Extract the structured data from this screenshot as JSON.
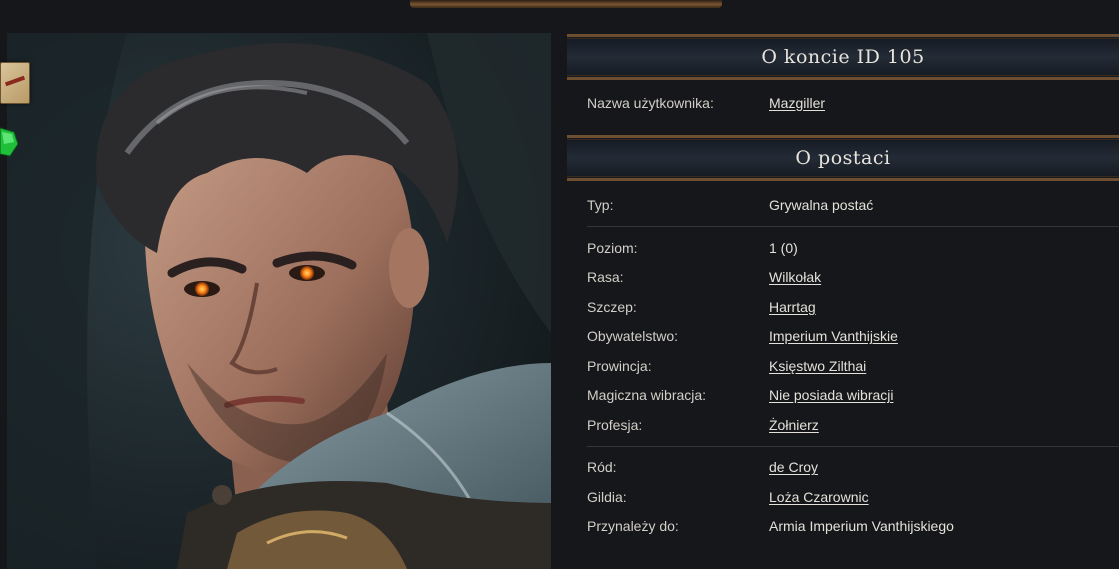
{
  "account_section": {
    "title": "O koncie ID 105",
    "rows": [
      {
        "label": "Nazwa użytkownika:",
        "value": "Mazgiller",
        "link": true
      }
    ]
  },
  "character_section": {
    "title": "O postaci",
    "type_row": {
      "label": "Typ:",
      "value": "Grywalna postać"
    },
    "rows": [
      {
        "label": "Poziom:",
        "value": "1 (0)",
        "link": false
      },
      {
        "label": "Rasa:",
        "value": "Wilkołak",
        "link": true
      },
      {
        "label": "Szczep:",
        "value": "Harrtag",
        "link": true
      },
      {
        "label": "Obywatelstwo:",
        "value": "Imperium Vanthijskie",
        "link": true
      },
      {
        "label": "Prowincja:",
        "value": "Księstwo Zilthai",
        "link": true
      },
      {
        "label": "Magiczna wibracja:",
        "value": "Nie posiada wibracji",
        "link": true
      },
      {
        "label": "Profesja:",
        "value": "Żołnierz",
        "link": true
      }
    ],
    "affiliation_rows": [
      {
        "label": "Ród:",
        "value": "de Croy",
        "link": true
      },
      {
        "label": "Gildia:",
        "value": "Loża Czarownic",
        "link": true
      },
      {
        "label": "Przynależy do:",
        "value": "Armia Imperium Vanthijskiego",
        "link": false
      }
    ]
  },
  "icons": {
    "scroll": "scroll-icon",
    "gem": "green-gem-icon"
  },
  "colors": {
    "background": "#16171a",
    "header_border": "#6d4e31",
    "eye_glow": "#ff8a1a"
  }
}
